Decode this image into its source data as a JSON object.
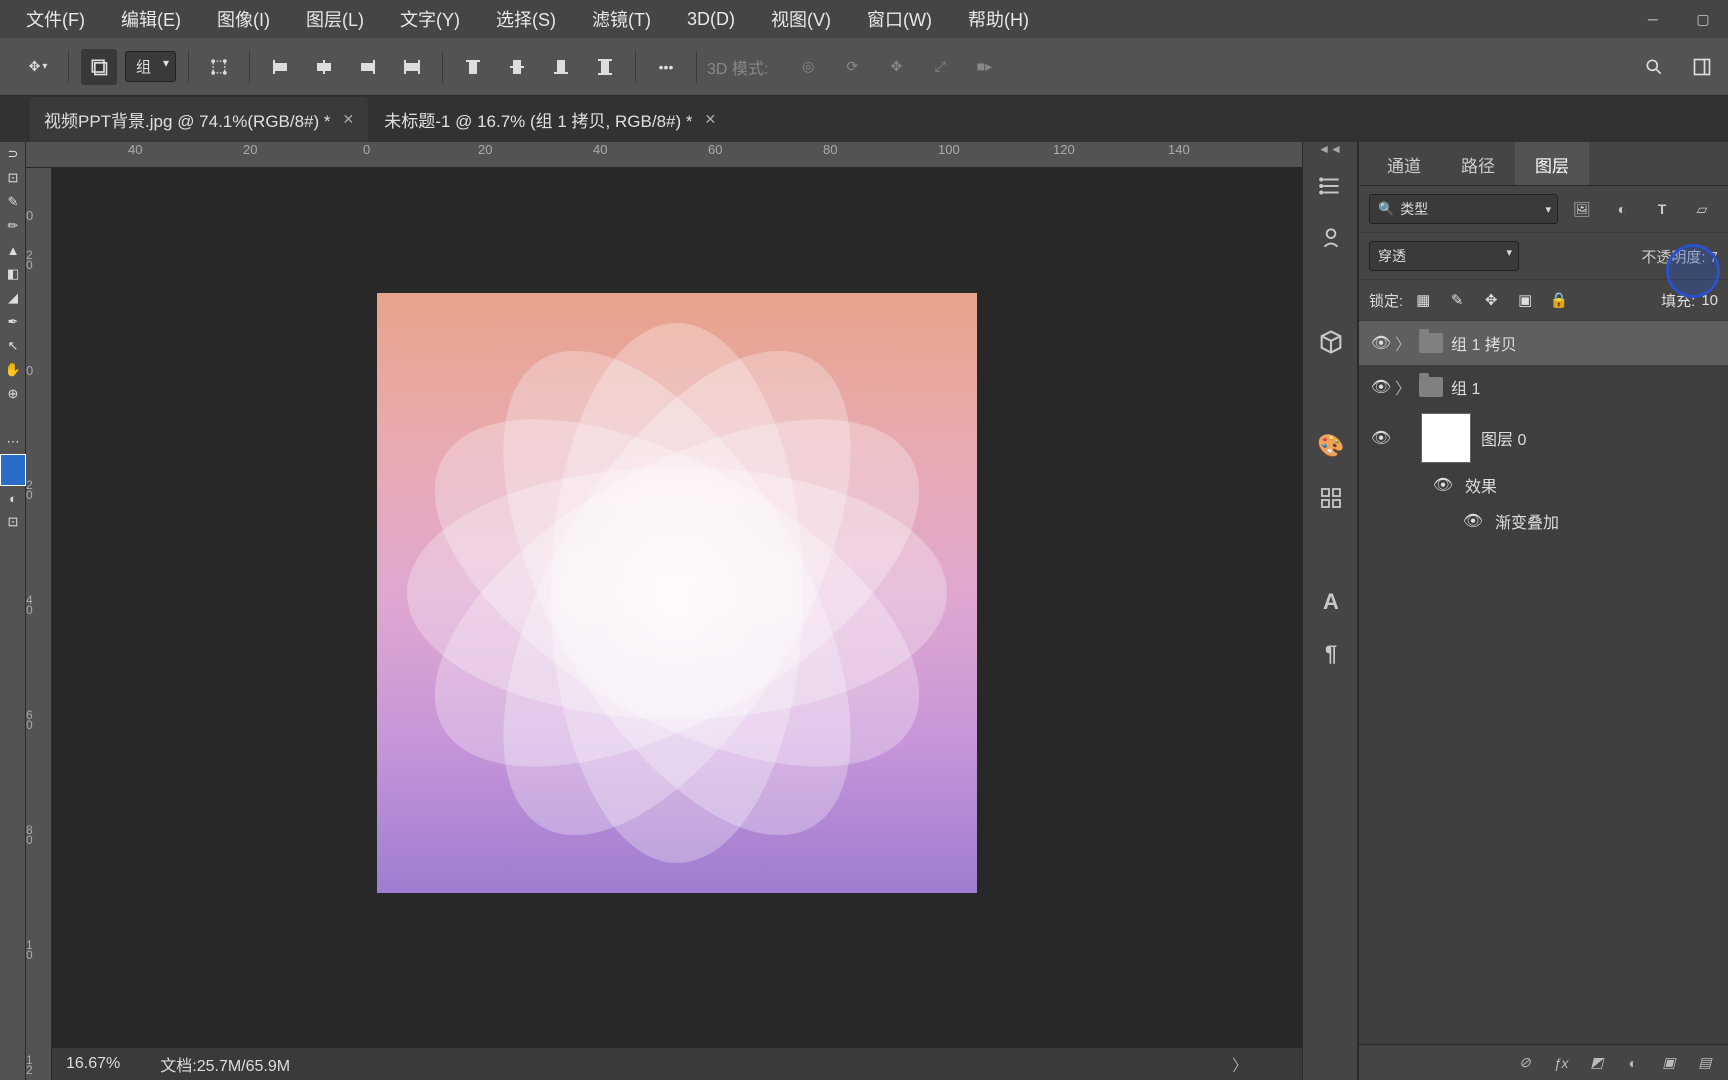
{
  "menu": [
    "文件(F)",
    "编辑(E)",
    "图像(I)",
    "图层(L)",
    "文字(Y)",
    "选择(S)",
    "滤镜(T)",
    "3D(D)",
    "视图(V)",
    "窗口(W)",
    "帮助(H)"
  ],
  "options": {
    "group_label": "组",
    "mode3d_label": "3D 模式:"
  },
  "tabs": [
    {
      "title": "视频PPT背景.jpg @ 74.1%(RGB/8#) *",
      "active": false
    },
    {
      "title": "未标题-1 @ 16.7% (组 1 拷贝, RGB/8#) *",
      "active": true
    }
  ],
  "ruler_h": [
    "40",
    "20",
    "0",
    "20",
    "40",
    "60",
    "80",
    "100",
    "120",
    "140"
  ],
  "ruler_v": [
    "0",
    "2 0",
    "0",
    "2 0",
    "4 0",
    "6 0",
    "8 0",
    "1 0",
    "1 2"
  ],
  "panel_tabs": {
    "channel": "通道",
    "path": "路径",
    "layers": "图层"
  },
  "layers_panel": {
    "type_filter": "类型",
    "blend_mode": "穿透",
    "opacity_label": "不透明度:",
    "lock_label": "锁定:",
    "fill_label": "填充:",
    "fill_value": "10",
    "opacity_value_partial": "7"
  },
  "layers": [
    {
      "name": "组 1 拷贝",
      "kind": "folder",
      "selected": true,
      "visible": true
    },
    {
      "name": "组 1",
      "kind": "folder",
      "selected": false,
      "visible": true
    },
    {
      "name": "图层 0",
      "kind": "layer",
      "selected": false,
      "visible": true,
      "effects": {
        "label": "效果",
        "items": [
          "渐变叠加"
        ]
      }
    }
  ],
  "status": {
    "zoom": "16.67%",
    "doc": "文档:25.7M/65.9M"
  }
}
